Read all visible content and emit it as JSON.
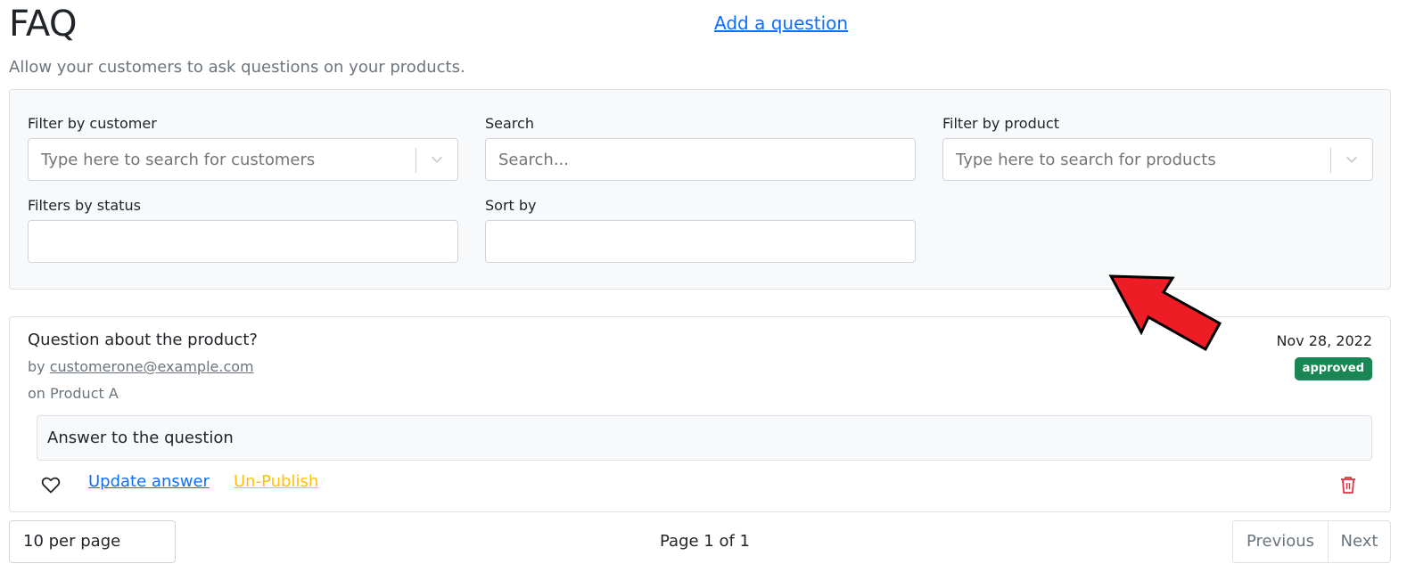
{
  "header": {
    "title": "FAQ",
    "add_question_label": "Add a question",
    "subtitle": "Allow your customers to ask questions on your products."
  },
  "filters": {
    "customer": {
      "label": "Filter by customer",
      "placeholder": "Type here to search for customers",
      "icon": "chevron-down-icon"
    },
    "search": {
      "label": "Search",
      "placeholder": "Search..."
    },
    "product": {
      "label": "Filter by product",
      "placeholder": "Type here to search for products",
      "icon": "chevron-down-icon"
    },
    "status": {
      "label": "Filters by status",
      "value": ""
    },
    "sort": {
      "label": "Sort by",
      "value": ""
    }
  },
  "question": {
    "title": "Question about the product?",
    "by_prefix": "by",
    "author": "customerone@example.com",
    "product": "on Product A",
    "date": "Nov 28, 2022",
    "status": "approved",
    "answer": "Answer to the question",
    "actions": {
      "like_icon": "heart-icon",
      "update_label": "Update answer",
      "unpublish_label": "Un-Publish",
      "delete_icon": "trash-icon"
    }
  },
  "pagination": {
    "per_page": "10 per page",
    "page_info": "Page 1 of 1",
    "previous_label": "Previous",
    "next_label": "Next"
  },
  "overlay": {
    "annotation_icon": "arrow-pointer-icon"
  },
  "colors": {
    "primary": "#0d6efd",
    "warning": "#ffc107",
    "success": "#198754",
    "danger": "#dc3545",
    "annotation": "#ee1c24"
  }
}
